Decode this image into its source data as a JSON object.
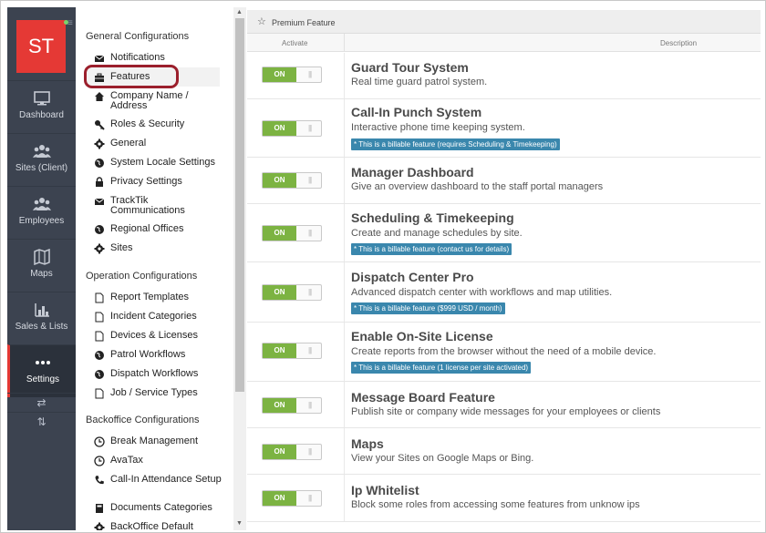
{
  "app": {
    "logo_text": "ST"
  },
  "rail": {
    "items": [
      {
        "label": "Dashboard",
        "icon": "monitor-icon"
      },
      {
        "label": "Sites (Client)",
        "icon": "people-icon"
      },
      {
        "label": "Employees",
        "icon": "people-icon"
      },
      {
        "label": "Maps",
        "icon": "map-icon"
      },
      {
        "label": "Sales & Lists",
        "icon": "bar-chart-icon"
      },
      {
        "label": "Settings",
        "icon": "more-dots-icon",
        "active": true
      }
    ],
    "swap_h": "⇄",
    "swap_v": "⇅"
  },
  "menu": {
    "general_title": "General Configurations",
    "general_items": [
      {
        "label": "Notifications",
        "icon": "envelope-icon"
      },
      {
        "label": "Features",
        "icon": "briefcase-icon",
        "selected": true
      },
      {
        "label": "Company Name / Address",
        "icon": "home-icon"
      },
      {
        "label": "Roles & Security",
        "icon": "key-icon"
      },
      {
        "label": "General",
        "icon": "gear-icon"
      },
      {
        "label": "System Locale Settings",
        "icon": "globe-icon"
      },
      {
        "label": "Privacy Settings",
        "icon": "lock-icon"
      },
      {
        "label": "TrackTik Communications",
        "icon": "envelope-icon"
      },
      {
        "label": "Regional Offices",
        "icon": "globe-icon"
      },
      {
        "label": "Sites",
        "icon": "gear-icon"
      }
    ],
    "operation_title": "Operation Configurations",
    "operation_items": [
      {
        "label": "Report Templates",
        "icon": "document-icon"
      },
      {
        "label": "Incident Categories",
        "icon": "document-icon"
      },
      {
        "label": "Devices & Licenses",
        "icon": "document-icon"
      },
      {
        "label": "Patrol Workflows",
        "icon": "globe-icon"
      },
      {
        "label": "Dispatch Workflows",
        "icon": "globe-icon"
      },
      {
        "label": "Job / Service Types",
        "icon": "document-icon"
      }
    ],
    "backoffice_title": "Backoffice Configurations",
    "backoffice_items": [
      {
        "label": "Break Management",
        "icon": "clock-icon"
      },
      {
        "label": "AvaTax",
        "icon": "clock-icon"
      },
      {
        "label": "Call-In Attendance Setup",
        "icon": "phone-icon"
      },
      {
        "label": "Documents Categories",
        "icon": "book-icon"
      },
      {
        "label": "BackOffice Default",
        "icon": "gear-icon"
      }
    ]
  },
  "main": {
    "premium_label": "Premium Feature",
    "col_activate": "Activate",
    "col_description": "Description",
    "toggle_on": "ON",
    "toggle_grip": "|||",
    "features": [
      {
        "title": "Guard Tour System",
        "desc": "Real time guard patrol system.",
        "badge": ""
      },
      {
        "title": "Call-In Punch System",
        "desc": "Interactive phone time keeping system.",
        "badge": "* This is a billable feature (requires Scheduling & Timekeeping)"
      },
      {
        "title": "Manager Dashboard",
        "desc": "Give an overview dashboard to the staff portal managers",
        "badge": ""
      },
      {
        "title": "Scheduling & Timekeeping",
        "desc": "Create and manage schedules by site.",
        "badge": "* This is a billable feature (contact us for details)"
      },
      {
        "title": "Dispatch Center Pro",
        "desc": "Advanced dispatch center with workflows and map utilities.",
        "badge": "* This is a billable feature ($999 USD / month)"
      },
      {
        "title": "Enable On-Site License",
        "desc": "Create reports from the browser without the need of a mobile device.",
        "badge": "* This is a billable feature (1 license per site activated)"
      },
      {
        "title": "Message Board Feature",
        "desc": "Publish site or company wide messages for your employees or clients",
        "badge": ""
      },
      {
        "title": "Maps",
        "desc": "View your Sites on Google Maps or Bing.",
        "badge": ""
      },
      {
        "title": "Ip Whitelist",
        "desc": "Block some roles from accessing some features from unknow ips",
        "badge": ""
      }
    ]
  },
  "colors": {
    "accent_red": "#e53935",
    "toggle_green": "#7cb342",
    "badge_blue": "#3a87ad",
    "rail_bg": "#3c4350",
    "highlight": "#9b1f2c"
  }
}
